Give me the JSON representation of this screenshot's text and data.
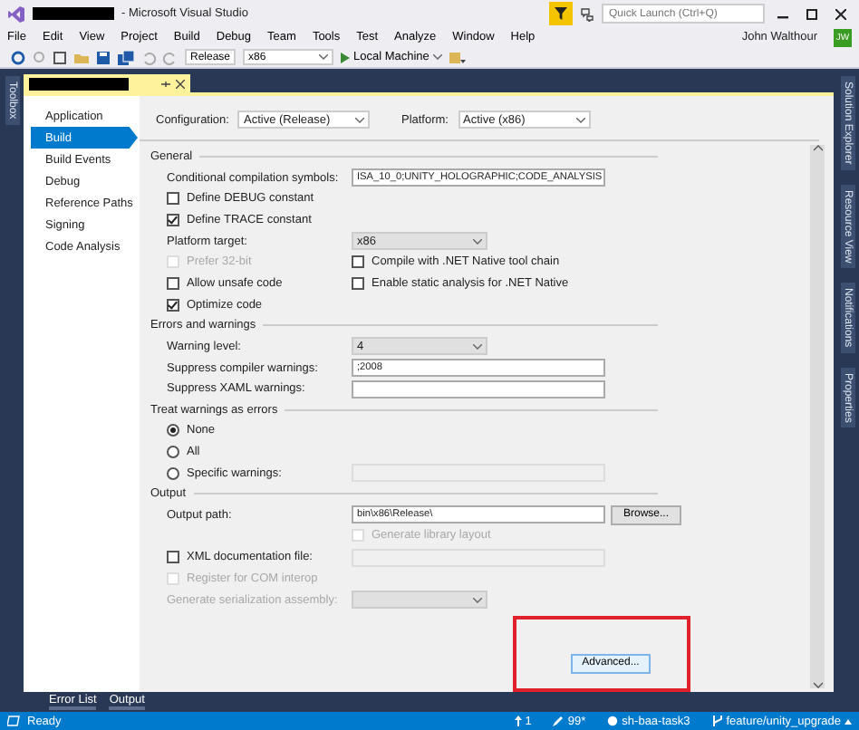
{
  "window": {
    "title": "- Microsoft Visual Studio",
    "quick_launch": {
      "placeholder": "Quick Launch (Ctrl+Q)"
    }
  },
  "menu": [
    "File",
    "Edit",
    "View",
    "Project",
    "Build",
    "Debug",
    "Team",
    "Tools",
    "Test",
    "Analyze",
    "Window",
    "Help"
  ],
  "user": {
    "name": "John Walthour",
    "initials": "JW"
  },
  "toolbar": {
    "configuration": "Release",
    "platform": "x86",
    "run": "Local Machine"
  },
  "left_tool_tabs": [
    "Toolbox"
  ],
  "right_tool_tabs": [
    "Solution Explorer",
    "Resource View",
    "Notifications",
    "Properties"
  ],
  "nav": [
    {
      "label": "Application",
      "selected": false
    },
    {
      "label": "Build",
      "selected": true
    },
    {
      "label": "Build Events",
      "selected": false
    },
    {
      "label": "Debug",
      "selected": false
    },
    {
      "label": "Reference Paths",
      "selected": false
    },
    {
      "label": "Signing",
      "selected": false
    },
    {
      "label": "Code Analysis",
      "selected": false
    }
  ],
  "header": {
    "configuration_label": "Configuration:",
    "configuration": "Active (Release)",
    "platform_label": "Platform:",
    "platform": "Active (x86)"
  },
  "sections": [
    {
      "title": "General",
      "rows": [
        {
          "kind": "field",
          "label": "Conditional compilation symbols:",
          "value": "ISA_10_0;UNITY_HOLOGRAPHIC;CODE_ANALYSIS",
          "disabled": false
        },
        {
          "kind": "checkbox",
          "label": "Define DEBUG constant",
          "checked": false,
          "disabled": false
        },
        {
          "kind": "checkbox",
          "label": "Define TRACE constant",
          "checked": true,
          "disabled": false
        },
        {
          "kind": "select",
          "label": "Platform target:",
          "value": "x86",
          "disabled": true
        },
        {
          "kind": "pair",
          "items": [
            {
              "label": "Prefer 32-bit",
              "checked": false,
              "disabled": true
            },
            {
              "label": "Compile with .NET Native tool chain",
              "checked": false,
              "disabled": false
            }
          ]
        },
        {
          "kind": "pair",
          "items": [
            {
              "label": "Allow unsafe code",
              "checked": false,
              "disabled": false
            },
            {
              "label": "Enable static analysis for .NET Native",
              "checked": false,
              "disabled": false
            }
          ]
        },
        {
          "kind": "checkbox",
          "label": "Optimize code",
          "checked": true,
          "disabled": false
        }
      ]
    },
    {
      "title": "Errors and warnings",
      "rows": [
        {
          "kind": "select",
          "label": "Warning level:",
          "value": "4",
          "disabled": true
        },
        {
          "kind": "field",
          "label": "Suppress compiler warnings:",
          "value": ";2008",
          "disabled": false
        },
        {
          "kind": "field",
          "label": "Suppress XAML warnings:",
          "disabled": false
        }
      ]
    },
    {
      "title": "Treat warnings as errors",
      "rows": [
        {
          "kind": "radio",
          "label": "None",
          "selected": true
        },
        {
          "kind": "radio",
          "label": "All",
          "selected": false
        },
        {
          "kind": "radio",
          "label": "Specific warnings:",
          "selected": false,
          "field_disabled": true
        }
      ]
    },
    {
      "title": "Output",
      "rows": [
        {
          "kind": "field",
          "label": "Output path:",
          "value": "bin\\x86\\Release\\",
          "disabled": false,
          "button": "Browse..."
        },
        {
          "kind": "sub_checkbox",
          "label": "Generate library layout",
          "checked": false,
          "disabled": true
        },
        {
          "kind": "checkbox_field",
          "label": "XML documentation file:",
          "checked": false,
          "disabled": false,
          "field_disabled": true
        },
        {
          "kind": "checkbox",
          "label": "Register for COM interop",
          "checked": false,
          "disabled": true
        },
        {
          "kind": "select",
          "label": "Generate serialization assembly:",
          "disabled": true
        }
      ]
    }
  ],
  "advanced_button": "Advanced...",
  "bottom_tabs": [
    "Error List",
    "Output"
  ],
  "status_bar": {
    "state": "Ready",
    "pushes": "1",
    "changes": "99*",
    "repo": "sh-baa-task3",
    "branch": "feature/unity_upgrade"
  }
}
